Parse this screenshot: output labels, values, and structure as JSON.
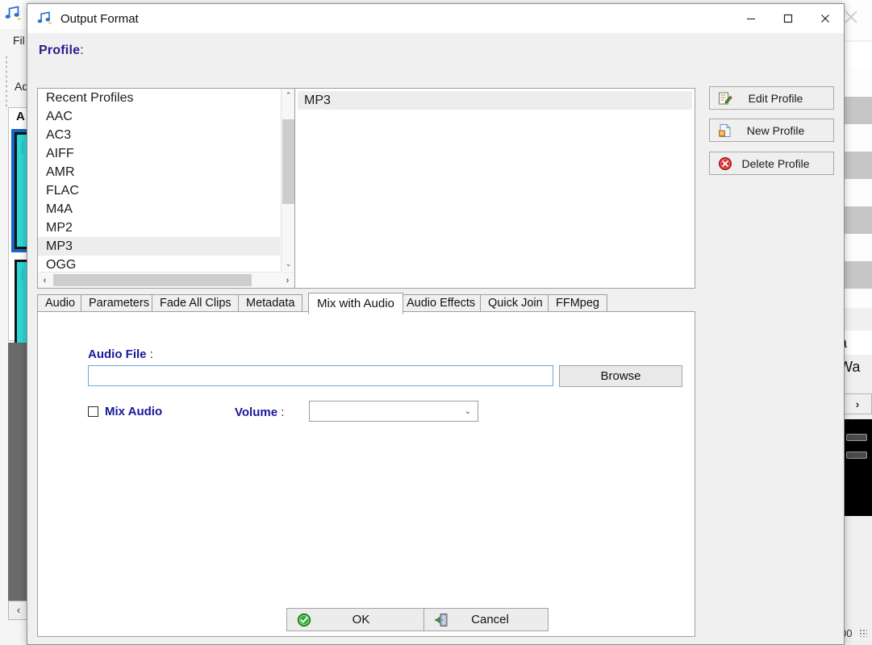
{
  "background_app": {
    "menu_label": "Fil",
    "add_label": "Ad",
    "panel_header": "A",
    "right_text": "a Wa",
    "scroll_right_arrow": "›",
    "bottom_left_arrow": "‹",
    "bottom_number": "00",
    "icon_titlebar": "music-note-icon",
    "icon_close": "close-icon"
  },
  "dialog": {
    "title": "Output Format",
    "title_icon": "music-note-icon",
    "window_buttons": {
      "minimize": "–",
      "maximize": "□",
      "close": "✕"
    },
    "profile_section": {
      "label": "Profile",
      "colon": ":",
      "list_items": [
        "Recent Profiles",
        "AAC",
        "AC3",
        "AIFF",
        "AMR",
        "FLAC",
        "M4A",
        "MP2",
        "MP3",
        "OGG"
      ],
      "selected_item": "MP3",
      "selected_index": 8,
      "detail_items": [
        "MP3"
      ],
      "scroll_up_arrow": "⌃",
      "scroll_down_arrow": "⌄",
      "scroll_left_arrow": "‹",
      "scroll_right_arrow": "›"
    },
    "profile_actions": [
      {
        "label": "Edit Profile",
        "icon": "edit-note-icon"
      },
      {
        "label": "New Profile",
        "icon": "new-document-icon"
      },
      {
        "label": "Delete Profile",
        "icon": "delete-circle-icon"
      }
    ],
    "tabs": [
      {
        "label": "Audio",
        "active": false
      },
      {
        "label": "Parameters",
        "active": false
      },
      {
        "label": "Fade All Clips",
        "active": false
      },
      {
        "label": "Metadata",
        "active": false
      },
      {
        "label": "Mix with Audio",
        "active": true
      },
      {
        "label": "Audio Effects",
        "active": false
      },
      {
        "label": "Quick Join",
        "active": false
      },
      {
        "label": "FFMpeg",
        "active": false
      }
    ],
    "mix_with_audio": {
      "audio_file_label": "Audio File",
      "audio_file_colon": ":",
      "audio_file_value": "",
      "audio_file_placeholder": "",
      "browse_label": "Browse",
      "mix_audio_label": "Mix Audio",
      "mix_audio_checked": false,
      "volume_label": "Volume",
      "volume_colon": ":",
      "volume_value": "",
      "volume_arrow": "⌄"
    },
    "footer": {
      "ok_label": "OK",
      "ok_icon": "green-check-icon",
      "cancel_label": "Cancel",
      "cancel_icon": "exit-door-icon"
    }
  },
  "colors": {
    "dialog_bg": "#f0f0f0",
    "heading_purple": "#2a1b8e",
    "label_blue": "#18189c",
    "selection_gray": "#ededed",
    "focus_border": "#6aa9d8",
    "clip_teal": "#2fd6d6",
    "selection_blue": "#1666c4",
    "delete_red": "#d32f2f",
    "ok_green": "#2ea82e"
  }
}
